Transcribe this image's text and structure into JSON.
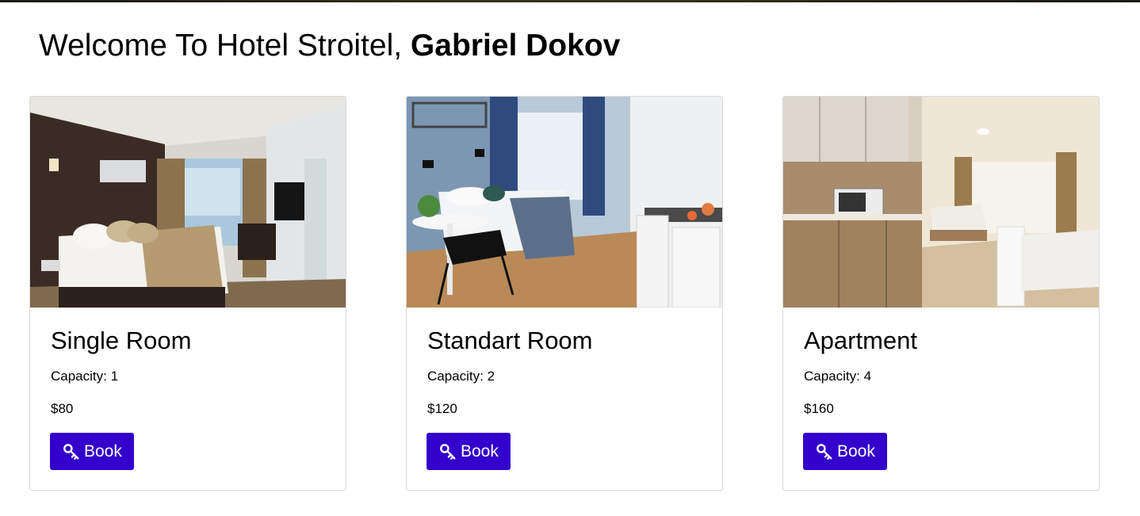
{
  "header": {
    "welcome_prefix": "Welcome To Hotel Stroitel, ",
    "guest_name": "Gabriel Dokov"
  },
  "rooms": [
    {
      "name": "Single Room",
      "capacity_label": "Capacity:",
      "capacity": "1",
      "price": "$80",
      "book_label": "Book",
      "book_icon": "key-icon"
    },
    {
      "name": "Standart Room",
      "capacity_label": "Capacity:",
      "capacity": "2",
      "price": "$120",
      "book_label": "Book",
      "book_icon": "key-icon"
    },
    {
      "name": "Apartment",
      "capacity_label": "Capacity:",
      "capacity": "4",
      "price": "$160",
      "book_label": "Book",
      "book_icon": "key-icon"
    }
  ],
  "colors": {
    "button_bg": "#3300cc",
    "button_text": "#ffffff",
    "card_border": "#d9d9d9"
  }
}
